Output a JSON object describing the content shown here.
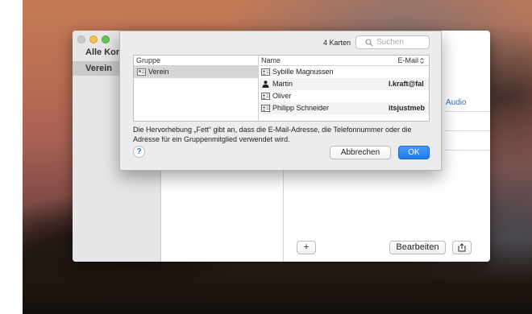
{
  "sidebar": {
    "items": [
      {
        "label": "Alle Kontakte"
      },
      {
        "label": "Verein"
      }
    ]
  },
  "detail": {
    "audio_link": "Audio"
  },
  "toolbar": {
    "add_label": "+",
    "edit_label": "Bearbeiten",
    "share_icon": "share-icon"
  },
  "dialog": {
    "count": "4 Karten",
    "search_placeholder": "Suchen",
    "group_header": "Gruppe",
    "name_header": "Name",
    "email_header": "E-Mail",
    "group": {
      "label": "Verein",
      "icon": "group-card-icon"
    },
    "contacts": [
      {
        "name": "Sybille Magnussen",
        "email": "",
        "icon": "contact-card-icon"
      },
      {
        "name": "Martin",
        "email": "l.kraft@fal",
        "icon": "person-silhouette-icon"
      },
      {
        "name": "Oliver",
        "email": "",
        "icon": "contact-card-icon"
      },
      {
        "name": "Philipp Schneider",
        "email": "itsjustmeb",
        "icon": "contact-card-icon"
      }
    ],
    "info_text": "Die Hervorhebung „Fett“ gibt an, dass die E-Mail-Adresse, die Telefonnummer oder die Adresse für ein Gruppenmitglied verwendet wird.",
    "help_label": "?",
    "cancel_label": "Abbrechen",
    "ok_label": "OK"
  },
  "colors": {
    "accent": "#1f7ae8",
    "link": "#2a6fd0",
    "selection": "#d6d6d6"
  }
}
